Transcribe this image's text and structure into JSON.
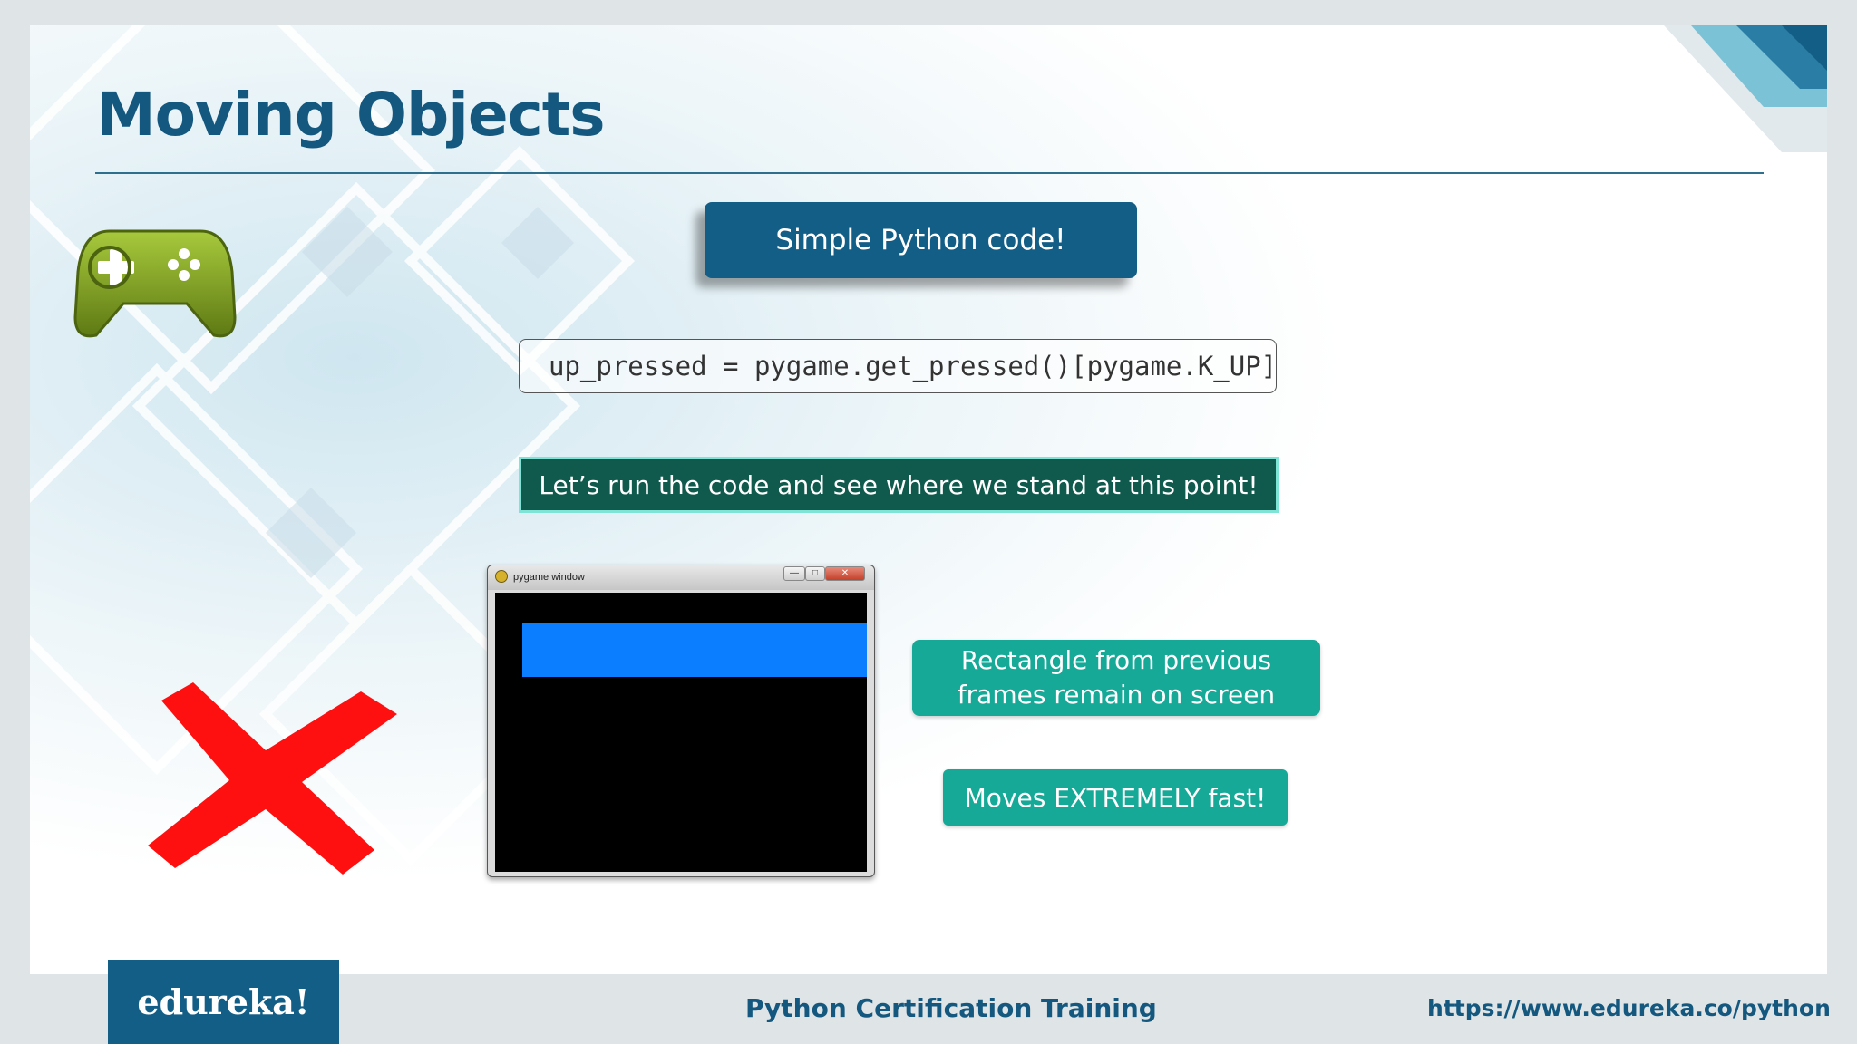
{
  "slide": {
    "title": "Moving Objects",
    "callout": "Simple Python code!",
    "code": "up_pressed = pygame.get_pressed()[pygame.K_UP]",
    "banner": "Let’s run the code and see where we stand at this point!",
    "pygame_window": {
      "title": "pygame window",
      "minimize": "—",
      "maximize": "□",
      "close": "✕"
    },
    "notes": [
      {
        "line1": "Rectangle from previous",
        "line2": "frames remain on screen"
      },
      {
        "text": "Moves EXTREMELY fast!"
      }
    ],
    "icons": [
      "gamepad-icon",
      "red-cross-icon"
    ]
  },
  "footer": {
    "logo": "edureka!",
    "course": "Python Certification Training",
    "url": "https://www.edureka.co/python"
  },
  "colors": {
    "title": "#14587f",
    "callout_bg": "#135e86",
    "banner_bg": "#0f5a4d",
    "note_bg": "#17a998",
    "rect": "#0a7eff",
    "cross": "#ff1010"
  }
}
